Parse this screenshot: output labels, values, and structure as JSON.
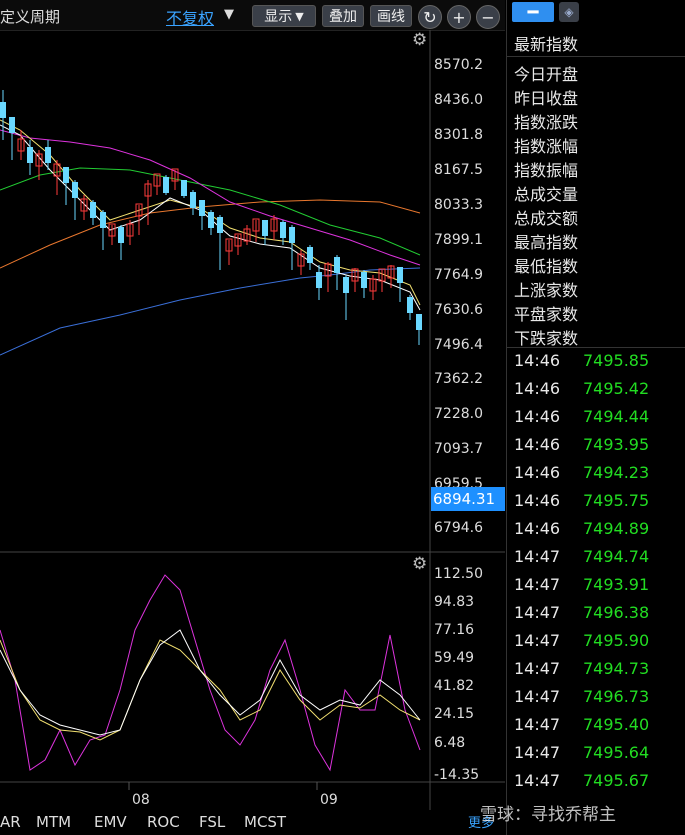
{
  "toolbar": {
    "period_label": "定义周期",
    "adjust_select": "不复权",
    "display_btn": "显示",
    "overlay_btn": "叠加",
    "draw_btn": "画线",
    "refresh_icon": "refresh-icon",
    "zoom_in_icon": "plus-icon",
    "zoom_out_icon": "minus-icon"
  },
  "price_axis": [
    "8570.2",
    "8436.0",
    "8301.8",
    "8167.5",
    "8033.3",
    "7899.1",
    "7764.9",
    "7630.6",
    "7496.4",
    "7362.2",
    "7228.0",
    "7093.7",
    "6959.5",
    "6794.6"
  ],
  "current_price": "6894.31",
  "indicator_axis": [
    "112.50",
    "94.83",
    "77.16",
    "59.49",
    "41.82",
    "24.15",
    "6.48",
    "-14.35"
  ],
  "date_labels": [
    "08",
    "09"
  ],
  "indicator_tabs": [
    "AR",
    "MTM",
    "EMV",
    "ROC",
    "FSL",
    "MCST"
  ],
  "more_link": "更多",
  "right_panel": {
    "title": "最新指数",
    "fields": [
      "今日开盘",
      "昨日收盘",
      "指数涨跌",
      "指数涨幅",
      "指数振幅",
      "总成交量",
      "总成交额",
      "最高指数",
      "最低指数",
      "上涨家数",
      "平盘家数",
      "下跌家数"
    ],
    "ticks": [
      {
        "time": "14:46",
        "value": "7495.85"
      },
      {
        "time": "14:46",
        "value": "7495.42"
      },
      {
        "time": "14:46",
        "value": "7494.44"
      },
      {
        "time": "14:46",
        "value": "7493.95"
      },
      {
        "time": "14:46",
        "value": "7494.23"
      },
      {
        "time": "14:46",
        "value": "7495.75"
      },
      {
        "time": "14:46",
        "value": "7494.89"
      },
      {
        "time": "14:47",
        "value": "7494.74"
      },
      {
        "time": "14:47",
        "value": "7493.91"
      },
      {
        "time": "14:47",
        "value": "7496.38"
      },
      {
        "time": "14:47",
        "value": "7495.90"
      },
      {
        "time": "14:47",
        "value": "7494.73"
      },
      {
        "time": "14:47",
        "value": "7496.73"
      },
      {
        "time": "14:47",
        "value": "7495.40"
      },
      {
        "time": "14:47",
        "value": "7495.64"
      },
      {
        "time": "14:47",
        "value": "7495.67"
      }
    ]
  },
  "watermark": "雪球：寻找乔帮主",
  "colors": {
    "up": "#ff3b3b",
    "down": "#22dd22",
    "accent": "#2f8ff0",
    "candle_down": "#6ad8ff"
  }
}
